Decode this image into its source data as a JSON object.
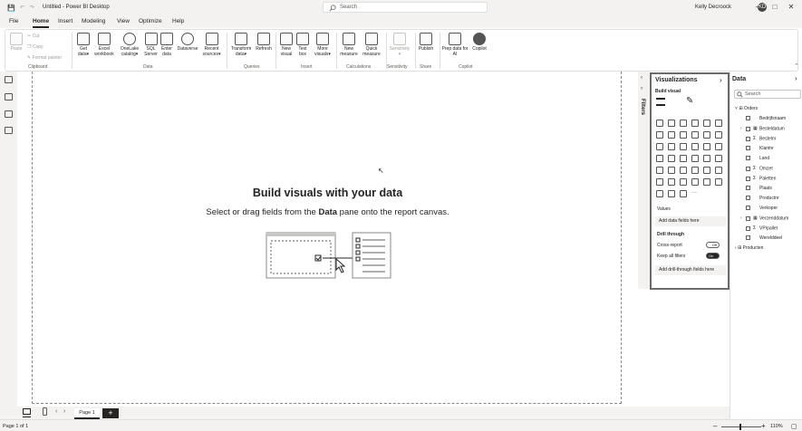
{
  "window": {
    "title": "Untitled - Power BI Desktop",
    "search_placeholder": "Search",
    "user_name": "Kelly Decroock",
    "user_initials": "KD"
  },
  "menu": {
    "file": "File",
    "home": "Home",
    "insert": "Insert",
    "modeling": "Modeling",
    "view": "View",
    "optimize": "Optimize",
    "help": "Help"
  },
  "ribbon": {
    "paste": "Paste",
    "cut": "Cut",
    "copy": "Copy",
    "format_painter": "Format painter",
    "clipboard": "Clipboard",
    "get_data": [
      "Get",
      "data"
    ],
    "excel": [
      "Excel",
      "workbook"
    ],
    "onelake": [
      "OneLake",
      "catalog"
    ],
    "sql": [
      "SQL",
      "Server"
    ],
    "enter_data": [
      "Enter",
      "data"
    ],
    "dataverse": "Dataverse",
    "recent": [
      "Recent",
      "sources"
    ],
    "data_group": "Data",
    "transform": [
      "Transform",
      "data"
    ],
    "refresh": "Refresh",
    "queries": "Queries",
    "new_visual": [
      "New",
      "visual"
    ],
    "text_box": [
      "Text",
      "box"
    ],
    "more_visuals": [
      "More",
      "visuals"
    ],
    "insert_group": "Insert",
    "new_measure": [
      "New",
      "measure"
    ],
    "quick_measure": [
      "Quick",
      "measure"
    ],
    "calculations": "Calculations",
    "sensitivity_btn": "Sensitivity",
    "sensitivity_group": "Sensitivity",
    "publish": "Publish",
    "share": "Share",
    "prep_data": [
      "Prep data for",
      "AI"
    ],
    "copilot": "Copilot",
    "copilot_group": "Copilot"
  },
  "canvas": {
    "placeholder_title": "Build visuals with your data",
    "placeholder_sub_before": "Select or drag fields from the ",
    "placeholder_sub_bold": "Data",
    "placeholder_sub_after": " pane onto the report canvas."
  },
  "filters": {
    "label": "Filters"
  },
  "visualizations": {
    "title": "Visualizations",
    "build_visual": "Build visual",
    "values": "Values",
    "add_data_fields": "Add data fields here",
    "drill_through": "Drill through",
    "cross_report": "Cross-report",
    "cross_report_state": "Off",
    "keep_all_filters": "Keep all filters",
    "keep_all_filters_state": "On",
    "add_drill_fields": "Add drill-through fields here"
  },
  "data_pane": {
    "title": "Data",
    "search_placeholder": "Search",
    "tables": [
      {
        "name": "Orders",
        "fields": [
          {
            "name": "Bedrijfsnaam",
            "sigma": false,
            "expandable": false
          },
          {
            "name": "Besteldatum",
            "sigma": false,
            "expandable": true
          },
          {
            "name": "Bestelnr",
            "sigma": true,
            "expandable": false
          },
          {
            "name": "Klantnr",
            "sigma": false,
            "expandable": false
          },
          {
            "name": "Land",
            "sigma": false,
            "expandable": false
          },
          {
            "name": "Omzet",
            "sigma": true,
            "expandable": false
          },
          {
            "name": "Paletten",
            "sigma": true,
            "expandable": false
          },
          {
            "name": "Plaats",
            "sigma": false,
            "expandable": false
          },
          {
            "name": "Productnr",
            "sigma": false,
            "expandable": false
          },
          {
            "name": "Verkoper",
            "sigma": false,
            "expandable": false
          },
          {
            "name": "Verzenddatum",
            "sigma": false,
            "expandable": true
          },
          {
            "name": "VP/pallet",
            "sigma": true,
            "expandable": false
          },
          {
            "name": "Werelddeel",
            "sigma": false,
            "expandable": false
          }
        ]
      },
      {
        "name": "Producten",
        "fields": []
      }
    ]
  },
  "page_tabs": {
    "page1": "Page 1",
    "add": "+"
  },
  "status": {
    "page_info": "Page 1 of 1",
    "zoom": "110%"
  }
}
